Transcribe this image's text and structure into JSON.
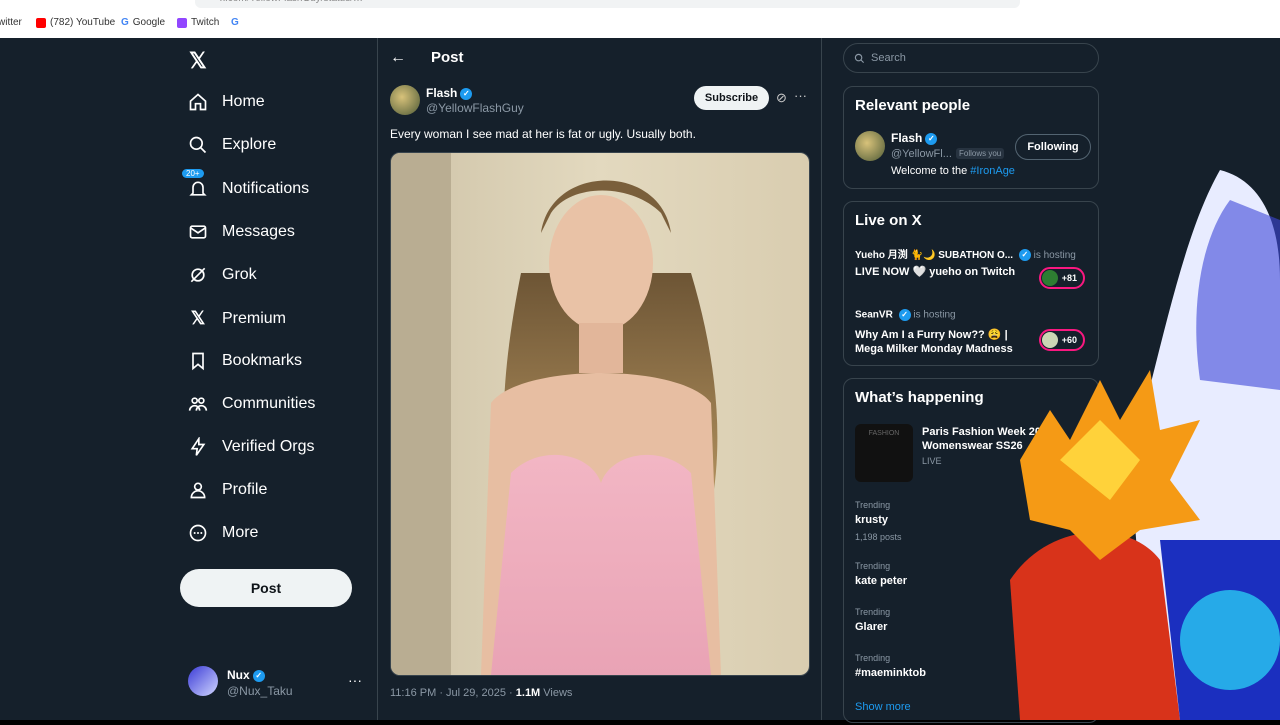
{
  "browser": {
    "bookmarks": [
      {
        "label": "witter",
        "icon": "twitter-icon",
        "color": "#1d9bf0"
      },
      {
        "label": "(782) YouTube",
        "icon": "youtube-icon",
        "color": "#ff0000"
      },
      {
        "label": "Google",
        "icon": "google-icon",
        "color": "#4285f4"
      },
      {
        "label": "Twitch",
        "icon": "twitch-icon",
        "color": "#9146ff"
      }
    ]
  },
  "nav": {
    "items": [
      {
        "label": "Home"
      },
      {
        "label": "Explore"
      },
      {
        "label": "Notifications",
        "badge": "20+"
      },
      {
        "label": "Messages"
      },
      {
        "label": "Grok"
      },
      {
        "label": "Premium"
      },
      {
        "label": "Bookmarks"
      },
      {
        "label": "Communities"
      },
      {
        "label": "Verified Orgs"
      },
      {
        "label": "Profile"
      },
      {
        "label": "More"
      }
    ],
    "post_label": "Post"
  },
  "account": {
    "name": "Nux",
    "handle": "@Nux_Taku"
  },
  "post": {
    "header_title": "Post",
    "author_name": "Flash",
    "author_handle": "@YellowFlashGuy",
    "subscribe_label": "Subscribe",
    "text": "Every woman I see mad at her is fat or ugly. Usually both.",
    "time": "11:16 PM · Jul 29, 2025 · ",
    "views_count": "1.1M",
    "views_label": " Views"
  },
  "search": {
    "placeholder": "Search"
  },
  "relevant": {
    "title": "Relevant people",
    "name": "Flash",
    "handle": "@YellowFl...",
    "follows_you": "Follows you",
    "follow_label": "Following",
    "bio_prefix": "Welcome to the ",
    "bio_tag": "#IronAge"
  },
  "live": {
    "title": "Live on X",
    "items": [
      {
        "host": "Yueho 月渕 🐈🌙 SUBATHON O...",
        "hosting": "is hosting",
        "title": "LIVE NOW 🤍 yueho on Twitch",
        "count": "+81"
      },
      {
        "host": "SeanVR",
        "hosting": "is hosting",
        "title": "Why Am I a Furry Now?? 😩 | Mega Milker Monday Madness",
        "count": "+60"
      }
    ]
  },
  "happening": {
    "title": "What’s happening",
    "event_title": "Paris Fashion Week 20 Womenswear SS26",
    "event_status": "LIVE",
    "thumb_label": "FASHION",
    "trends": [
      {
        "label": "Trending",
        "topic": "krusty",
        "count": "1,198 posts"
      },
      {
        "label": "Trending",
        "topic": "kate peter",
        "count": ""
      },
      {
        "label": "Trending",
        "topic": "Glarer",
        "count": ""
      },
      {
        "label": "Trending",
        "topic": "#maeminktob",
        "count": ""
      }
    ],
    "show_more": "Show more"
  },
  "colors": {
    "bg": "#15202b",
    "accent": "#1d9bf0",
    "border": "#38444d"
  }
}
